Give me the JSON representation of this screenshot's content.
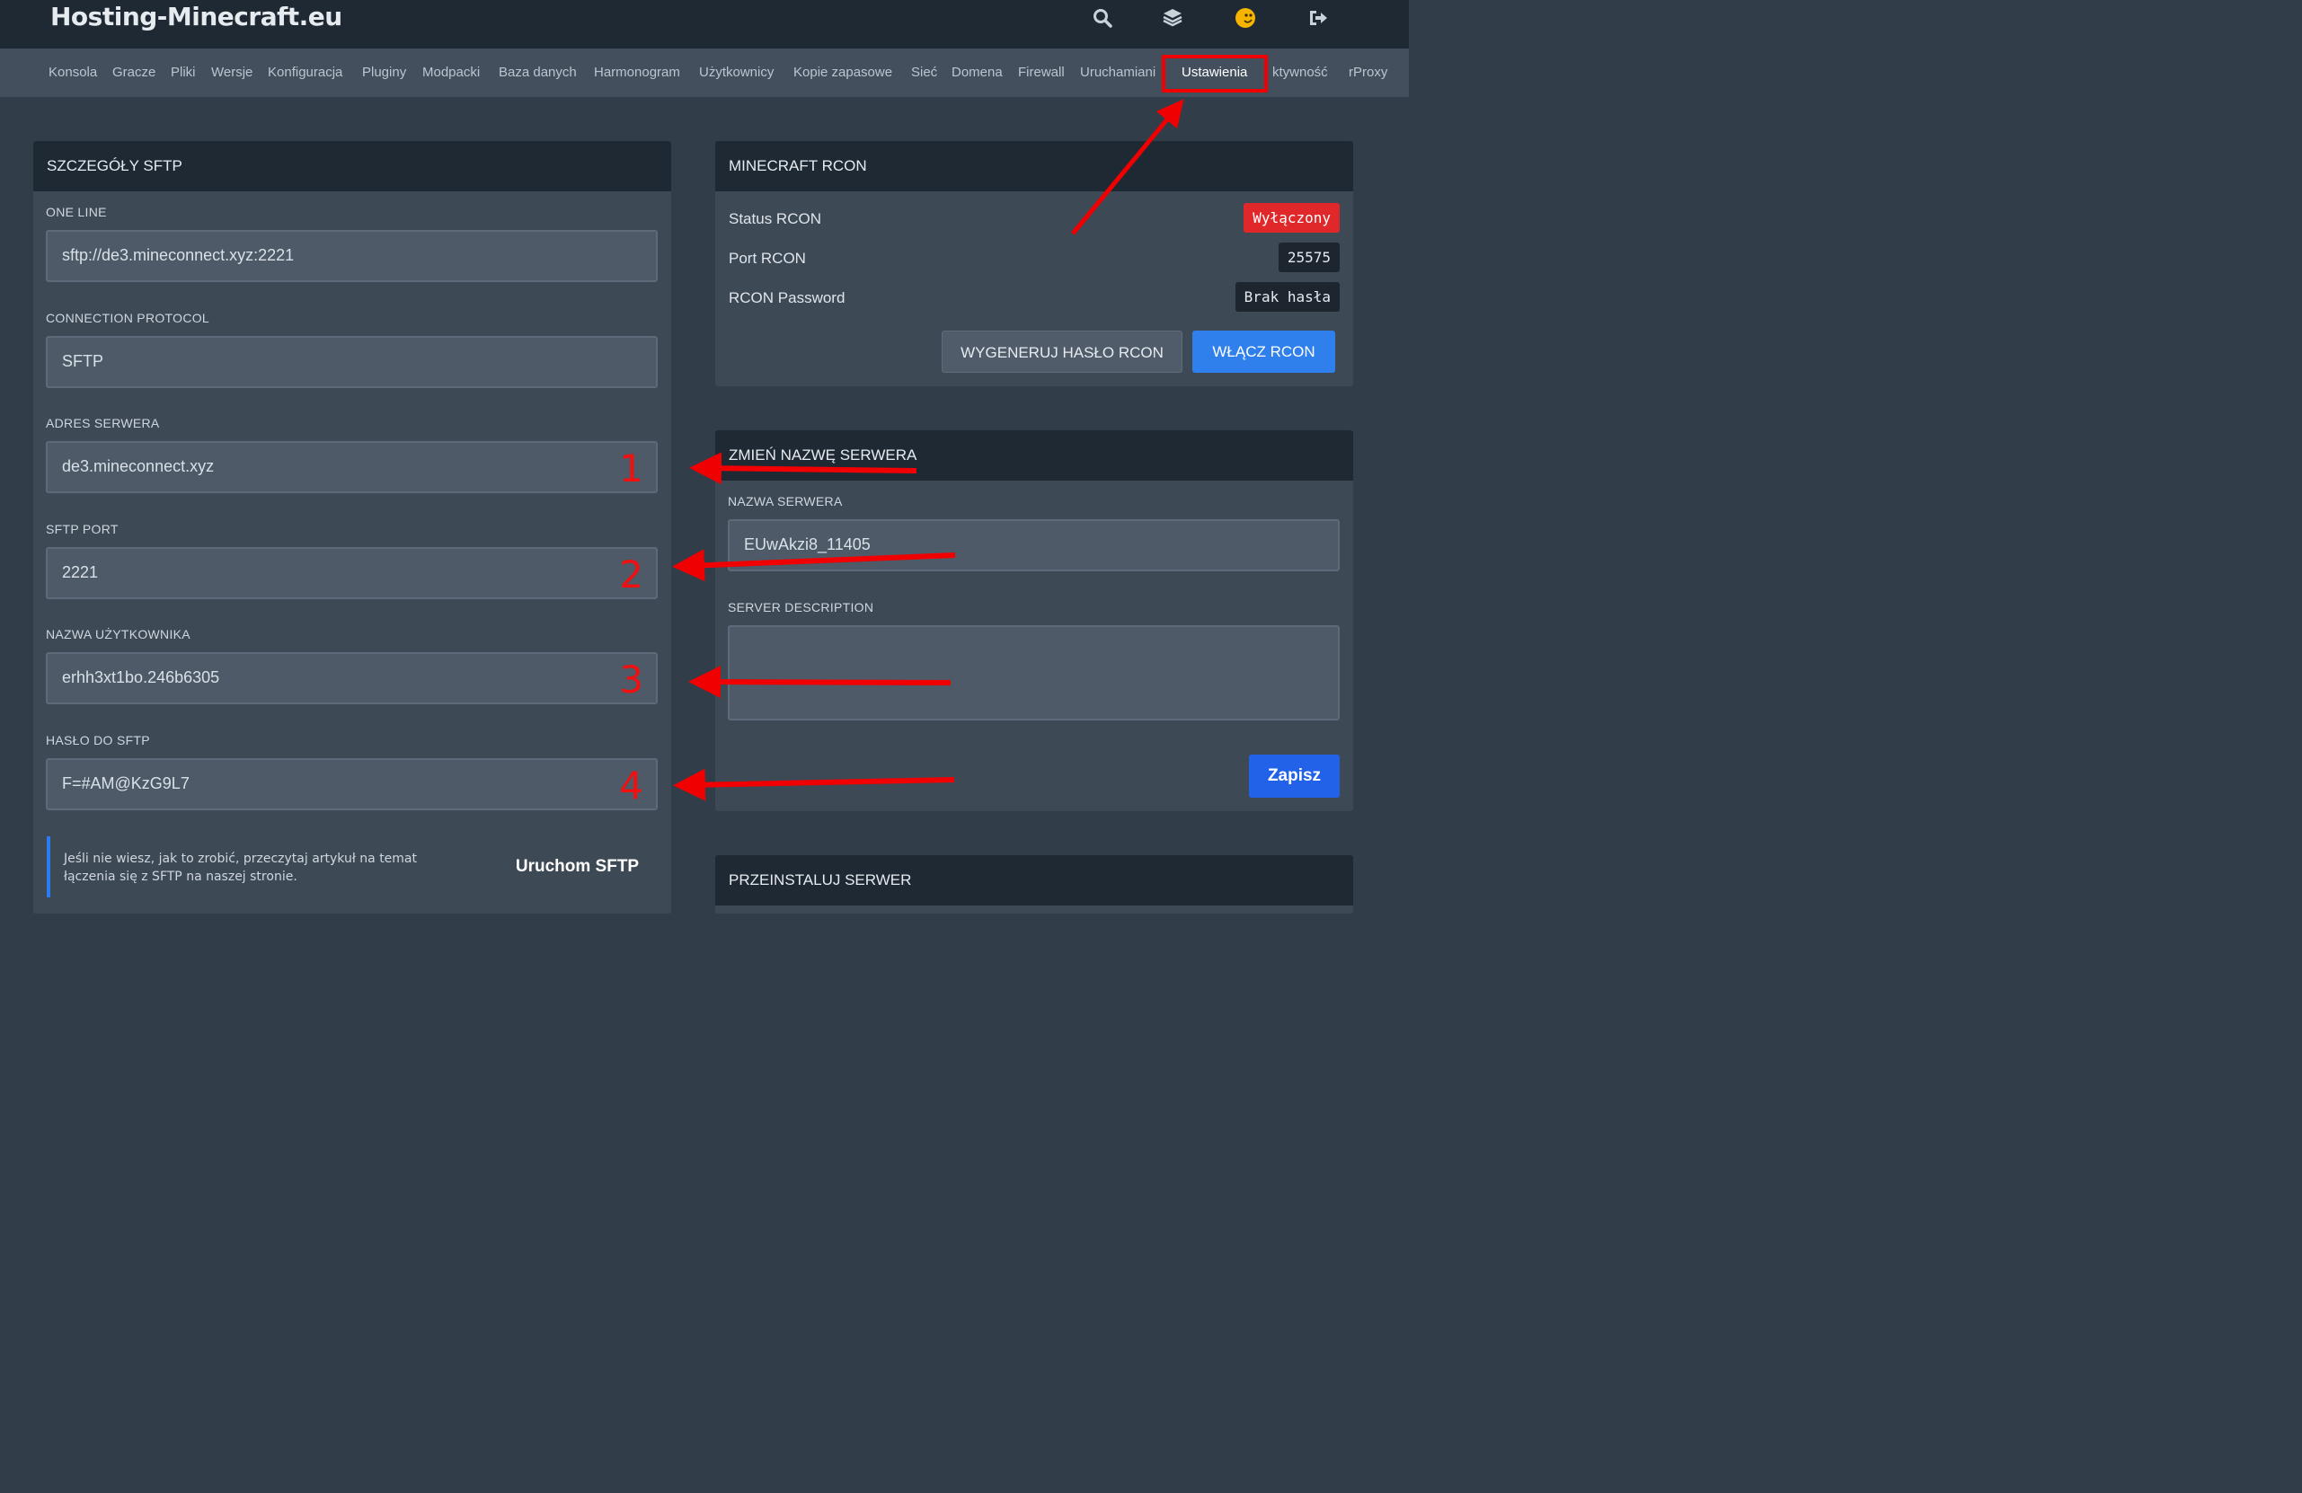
{
  "app": {
    "title": "Hosting-Minecraft.eu",
    "accent_color": "#2b7cf0",
    "annotation_color": "#f00000"
  },
  "topbar": {
    "icons": [
      "search-icon",
      "layers-icon",
      "user-avatar-icon",
      "logout-icon"
    ]
  },
  "nav": {
    "items": [
      "Konsola",
      "Gracze",
      "Pliki",
      "Wersje",
      "Konfiguracja",
      "Pluginy",
      "Modpacki",
      "Baza danych",
      "Harmonogram",
      "Użytkownicy",
      "Kopie zapasowe",
      "Sieć",
      "Domena",
      "Firewall",
      "Uruchamiani",
      "Ustawienia",
      "ktywność",
      "rProxy"
    ],
    "active": "Ustawienia"
  },
  "sftp": {
    "title": "SZCZEGÓŁY SFTP",
    "fields": [
      {
        "label": "ONE LINE",
        "value": "sftp://de3.mineconnect.xyz:2221",
        "marker": ""
      },
      {
        "label": "CONNECTION PROTOCOL",
        "value": "SFTP",
        "marker": ""
      },
      {
        "label": "ADRES SERWERA",
        "value": "de3.mineconnect.xyz",
        "marker": "1"
      },
      {
        "label": "SFTP PORT",
        "value": "2221",
        "marker": "2"
      },
      {
        "label": "NAZWA UŻYTKOWNIKA",
        "value": "erhh3xt1bo.246b6305",
        "marker": "3"
      },
      {
        "label": "HASŁO DO SFTP",
        "value": "F=#AM@KzG9L7",
        "marker": "4"
      }
    ],
    "note": "Jeśli nie wiesz, jak to zrobić, przeczytaj artykuł na temat łączenia się z SFTP na naszej stronie.",
    "launch_label": "Uruchom SFTP"
  },
  "rcon": {
    "title": "MINECRAFT RCON",
    "status_label": "Status RCON",
    "status_value": "Wyłączony",
    "status_color": "#e0282a",
    "port_label": "Port RCON",
    "port_value": "25575",
    "password_label": "RCON Password",
    "password_value": "Brak hasła",
    "generate_label": "WYGENERUJ HASŁO RCON",
    "enable_label": "WŁĄCZ RCON"
  },
  "rename": {
    "title": "ZMIEŃ NAZWĘ SERWERA",
    "name_label": "NAZWA SERWERA",
    "name_value": "EUwAkzi8_11405",
    "desc_label": "SERVER DESCRIPTION",
    "desc_value": "",
    "save_label": "Zapisz"
  },
  "reinstall": {
    "title": "PRZEINSTALUJ SERWER"
  }
}
